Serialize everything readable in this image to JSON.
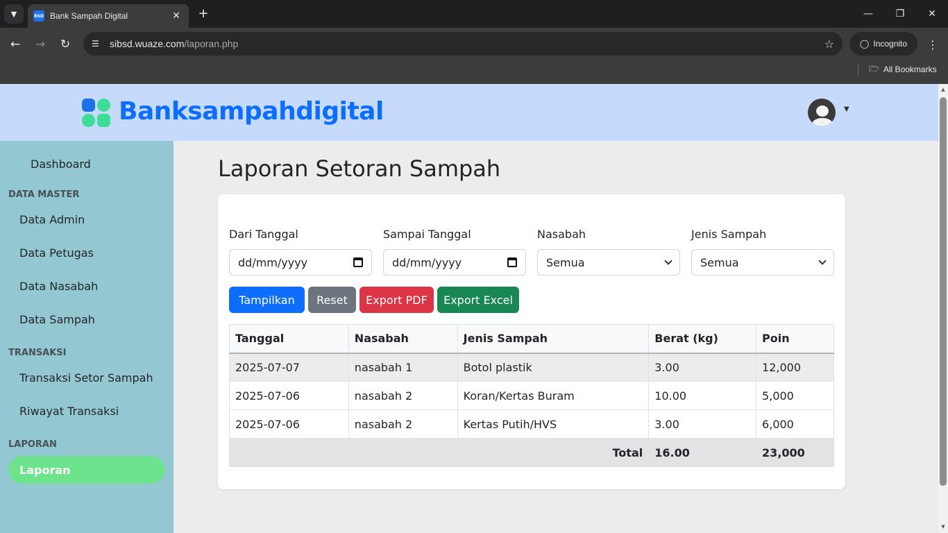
{
  "browser": {
    "tab_title": "Bank Sampah Digital",
    "favicon_text": "BSD",
    "url_host": "sibsd.wuaze.com",
    "url_path": "/laporan.php",
    "incognito_label": "Incognito",
    "all_bookmarks_label": "All Bookmarks"
  },
  "header": {
    "brand": "Banksampahdigital",
    "logo_color": "#1a73e8",
    "bg_color": "#c6dafc"
  },
  "sidebar": {
    "dashboard": "Dashboard",
    "section_master": "DATA MASTER",
    "data_admin": "Data Admin",
    "data_petugas": "Data Petugas",
    "data_nasabah": "Data Nasabah",
    "data_sampah": "Data Sampah",
    "section_transaksi": "TRANSAKSI",
    "transaksi_setor": "Transaksi Setor Sampah",
    "riwayat_transaksi": "Riwayat Transaksi",
    "section_laporan": "LAPORAN",
    "laporan": "Laporan",
    "bg_color": "#93c8d2",
    "active_color": "#6ee38d"
  },
  "main": {
    "title": "Laporan Setoran Sampah",
    "filters": {
      "from_label": "Dari Tanggal",
      "from_placeholder": "dd/mm/yyyy",
      "to_label": "Sampai Tanggal",
      "to_placeholder": "dd/mm/yyyy",
      "nasabah_label": "Nasabah",
      "nasabah_value": "Semua",
      "jenis_label": "Jenis Sampah",
      "jenis_value": "Semua"
    },
    "buttons": {
      "tampilkan": "Tampilkan",
      "reset": "Reset",
      "export_pdf": "Export PDF",
      "export_excel": "Export Excel"
    },
    "button_colors": {
      "tampilkan": "#0d6efd",
      "reset": "#6c757d",
      "export_pdf": "#dc3545",
      "export_excel": "#198754"
    },
    "table": {
      "headers": [
        "Tanggal",
        "Nasabah",
        "Jenis Sampah",
        "Berat (kg)",
        "Poin"
      ],
      "rows": [
        [
          "2025-07-07",
          "nasabah 1",
          "Botol plastik",
          "3.00",
          "12,000"
        ],
        [
          "2025-07-06",
          "nasabah 2",
          "Koran/Kertas Buram",
          "10.00",
          "5,000"
        ],
        [
          "2025-07-06",
          "nasabah 2",
          "Kertas Putih/HVS",
          "3.00",
          "6,000"
        ]
      ],
      "total_label": "Total",
      "total_berat": "16.00",
      "total_poin": "23,000"
    }
  }
}
